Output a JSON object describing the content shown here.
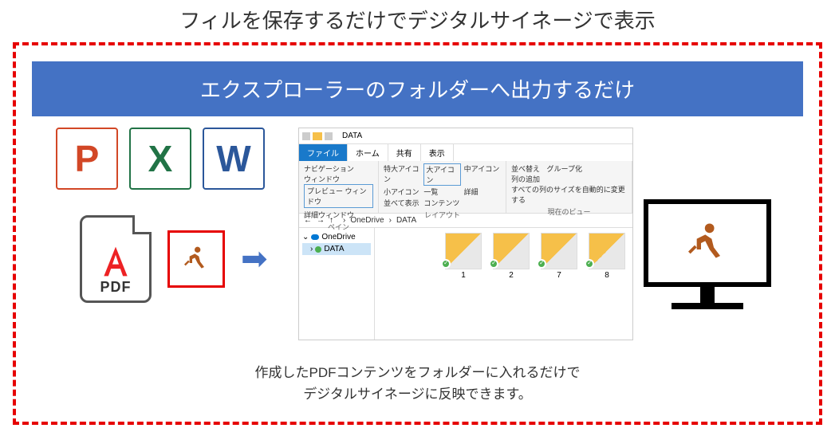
{
  "title": "フィルを保存するだけでデジタルサイネージで表示",
  "banner": "エクスプローラーのフォルダーへ出力するだけ",
  "office": {
    "ppt": "P",
    "xls": "X",
    "doc": "W"
  },
  "pdf": {
    "label": "PDF"
  },
  "arrow_glyph": "➡",
  "explorer": {
    "win_title": "DATA",
    "tabs": {
      "file": "ファイル",
      "home": "ホーム",
      "share": "共有",
      "view": "表示"
    },
    "ribbon": {
      "navpane": "ナビゲーション\nウィンドウ",
      "preview": "プレビュー ウィンドウ",
      "detail": "詳細ウィンドウ",
      "sec1_label": "ペイン",
      "ex_large": "特大アイコン",
      "large": "大アイコン",
      "medium": "中アイコン",
      "small": "小アイコン",
      "list": "一覧",
      "details": "詳細",
      "tile": "並べて表示",
      "content": "コンテンツ",
      "sec2_label": "レイアウト",
      "sort": "並べ替え",
      "group": "グループ化",
      "addcol": "列の追加",
      "autosize": "すべての列のサイズを自動的に変更する",
      "sec3_label": "現在のビュー"
    },
    "path": {
      "root": "OneDrive",
      "folder": "DATA",
      "sep": "›"
    },
    "tree": {
      "onedrive": "OneDrive",
      "data": "DATA"
    },
    "files": [
      {
        "name": "1"
      },
      {
        "name": "2"
      },
      {
        "name": "7"
      },
      {
        "name": "8"
      }
    ]
  },
  "footer": {
    "line1": "作成したPDFコンテンツをフォルダーに入れるだけで",
    "line2": "デジタルサイネージに反映できます。"
  }
}
